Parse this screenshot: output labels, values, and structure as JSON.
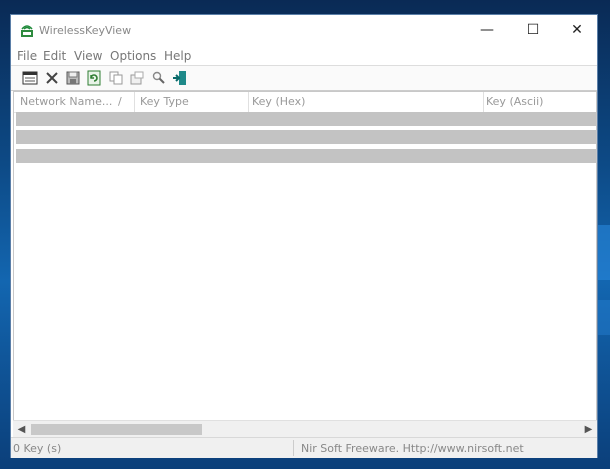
{
  "window": {
    "title": "WirelessKeyView",
    "minimize": "—",
    "maximize": "☐",
    "close": "✕"
  },
  "menu": [
    "File",
    "Edit",
    "View",
    "Options",
    "Help"
  ],
  "toolbar": {
    "icons": [
      "properties-icon",
      "delete-icon",
      "save-icon",
      "refresh-icon",
      "copy-icon",
      "html-report-icon",
      "find-icon",
      "exit-icon"
    ]
  },
  "table": {
    "columns": [
      "Network Name...",
      "Key Type",
      "Key (Hex)",
      "Key (Ascii)"
    ],
    "sort_indicator": "/",
    "row_count_visible": 3
  },
  "statusbar": {
    "count": "0 Key (s)",
    "credit": "Nir Soft Freeware. Http://www.nirsoft.net"
  },
  "colors": {
    "row_selected": "#c3c3c3",
    "accent": "#1f8a3a"
  }
}
